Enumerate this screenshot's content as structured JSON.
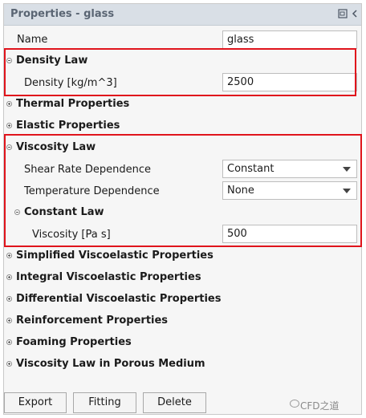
{
  "panel": {
    "title": "Properties - glass"
  },
  "name_row": {
    "label": "Name",
    "value": "glass"
  },
  "density_law": {
    "title": "Density Law",
    "density_label": "Density [kg/m^3]",
    "density_value": "2500"
  },
  "sections_collapsed_top": [
    "Thermal Properties",
    "Elastic Properties"
  ],
  "viscosity_law": {
    "title": "Viscosity Law",
    "shear_label": "Shear Rate Dependence",
    "shear_value": "Constant",
    "temp_label": "Temperature Dependence",
    "temp_value": "None",
    "constant_law": {
      "title": "Constant Law",
      "viscosity_label": "Viscosity [Pa s]",
      "viscosity_value": "500"
    }
  },
  "sections_collapsed_bottom": [
    "Simplified Viscoelastic Properties",
    "Integral Viscoelastic Properties",
    "Differential Viscoelastic Properties",
    "Reinforcement Properties",
    "Foaming Properties",
    "Viscosity Law in Porous Medium"
  ],
  "buttons": {
    "export": "Export",
    "fitting": "Fitting",
    "delete": "Delete"
  },
  "watermark": "CFD之道",
  "colors": {
    "highlight": "#e0141c",
    "titlebar": "#d9dfe6"
  }
}
